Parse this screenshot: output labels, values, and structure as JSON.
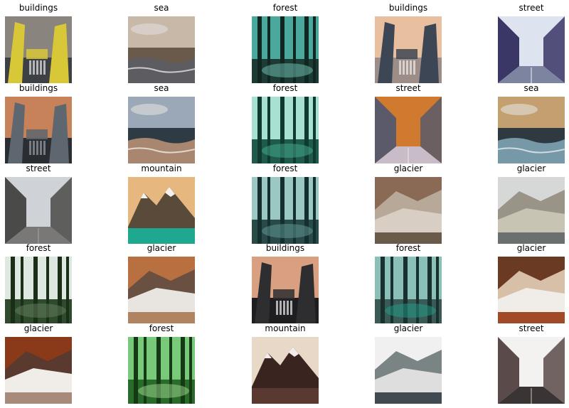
{
  "thumbnails": [
    {
      "label": "buildings",
      "scene": "buildings",
      "palette": {
        "sky": "#8a847e",
        "ground": "#3d4044",
        "accent": "#d8c838",
        "detail": "#e8e8e8"
      }
    },
    {
      "label": "sea",
      "scene": "sea",
      "palette": {
        "sky": "#c8b8a8",
        "ground": "#6a5a4c",
        "accent": "#5a5e66",
        "detail": "#e6e6e6"
      }
    },
    {
      "label": "forest",
      "scene": "forest",
      "palette": {
        "sky": "#4aa89c",
        "ground": "#1e3a34",
        "accent": "#0f2621",
        "detail": "#7fd6c8"
      }
    },
    {
      "label": "buildings",
      "scene": "buildings",
      "palette": {
        "sky": "#e8c0a0",
        "ground": "#9c8d88",
        "accent": "#3d4654",
        "detail": "#f2ede8"
      }
    },
    {
      "label": "street",
      "scene": "street",
      "palette": {
        "sky": "#dde4f0",
        "ground": "#7c84a0",
        "accent": "#3a3666",
        "detail": "#f0f0f0"
      }
    },
    {
      "label": "buildings",
      "scene": "buildings",
      "palette": {
        "sky": "#c8825a",
        "ground": "#2a2e33",
        "accent": "#5e6670",
        "detail": "#9aa0a8"
      }
    },
    {
      "label": "sea",
      "scene": "sea",
      "palette": {
        "sky": "#9aa8b8",
        "ground": "#2e3a44",
        "accent": "#c89a7a",
        "detail": "#f0ece6"
      }
    },
    {
      "label": "forest",
      "scene": "forest",
      "palette": {
        "sky": "#a8e0d4",
        "ground": "#1f5a4a",
        "accent": "#0f3a30",
        "detail": "#4cb89e"
      }
    },
    {
      "label": "street",
      "scene": "street",
      "palette": {
        "sky": "#d07a30",
        "ground": "#c8bcc8",
        "accent": "#5a5a6a",
        "detail": "#f0e8f0"
      }
    },
    {
      "label": "sea",
      "scene": "sea",
      "palette": {
        "sky": "#c4a070",
        "ground": "#2e3a40",
        "accent": "#8ab0c0",
        "detail": "#e6eef0"
      }
    },
    {
      "label": "street",
      "scene": "street",
      "palette": {
        "sky": "#cfd2d6",
        "ground": "#7a7876",
        "accent": "#4a4a48",
        "detail": "#a8a29a"
      }
    },
    {
      "label": "mountain",
      "scene": "mountain",
      "palette": {
        "sky": "#e6b880",
        "ground": "#1ea890",
        "accent": "#5a4a3a",
        "detail": "#f4f0ec"
      }
    },
    {
      "label": "forest",
      "scene": "forest",
      "palette": {
        "sky": "#9cc8c4",
        "ground": "#2a4a48",
        "accent": "#14302e",
        "detail": "#6aa8a2"
      }
    },
    {
      "label": "glacier",
      "scene": "glacier",
      "palette": {
        "sky": "#8a6a54",
        "ground": "#6a5a4a",
        "accent": "#d8cec4",
        "detail": "#b8a898"
      }
    },
    {
      "label": "glacier",
      "scene": "glacier",
      "palette": {
        "sky": "#d6d8d8",
        "ground": "#6a7070",
        "accent": "#c8c4b4",
        "detail": "#9a9488"
      }
    },
    {
      "label": "forest",
      "scene": "forest",
      "palette": {
        "sky": "#dfe8e0",
        "ground": "#2f4a2c",
        "accent": "#1a2e18",
        "detail": "#6e8a66"
      }
    },
    {
      "label": "glacier",
      "scene": "glacier",
      "palette": {
        "sky": "#b87040",
        "ground": "#b08460",
        "accent": "#e8e4e0",
        "detail": "#6a5040"
      }
    },
    {
      "label": "buildings",
      "scene": "buildings",
      "palette": {
        "sky": "#d8a080",
        "ground": "#1e1e20",
        "accent": "#2e2e30",
        "detail": "#f0f0f0"
      }
    },
    {
      "label": "forest",
      "scene": "forest",
      "palette": {
        "sky": "#8ac0b8",
        "ground": "#3a5a58",
        "accent": "#1a302e",
        "detail": "#20a890"
      }
    },
    {
      "label": "glacier",
      "scene": "glacier",
      "palette": {
        "sky": "#6a3a22",
        "ground": "#a04a28",
        "accent": "#f0ece8",
        "detail": "#d8c0a8"
      }
    },
    {
      "label": "glacier",
      "scene": "glacier",
      "palette": {
        "sky": "#8a3a18",
        "ground": "#a88a7a",
        "accent": "#f0ece8",
        "detail": "#5a3a2e"
      }
    },
    {
      "label": "forest",
      "scene": "forest",
      "palette": {
        "sky": "#7ac87a",
        "ground": "#2a6a2a",
        "accent": "#143a14",
        "detail": "#b0e8a0"
      }
    },
    {
      "label": "mountain",
      "scene": "mountain",
      "palette": {
        "sky": "#e8d8c8",
        "ground": "#5a3a30",
        "accent": "#3a2420",
        "detail": "#f4ecec"
      }
    },
    {
      "label": "glacier",
      "scene": "glacier",
      "palette": {
        "sky": "#f0f0f0",
        "ground": "#404a50",
        "accent": "#dedede",
        "detail": "#7a8484"
      }
    },
    {
      "label": "street",
      "scene": "street",
      "palette": {
        "sky": "#f4f2f0",
        "ground": "#3a3434",
        "accent": "#5a4a4a",
        "detail": "#c8c0b8"
      }
    }
  ]
}
